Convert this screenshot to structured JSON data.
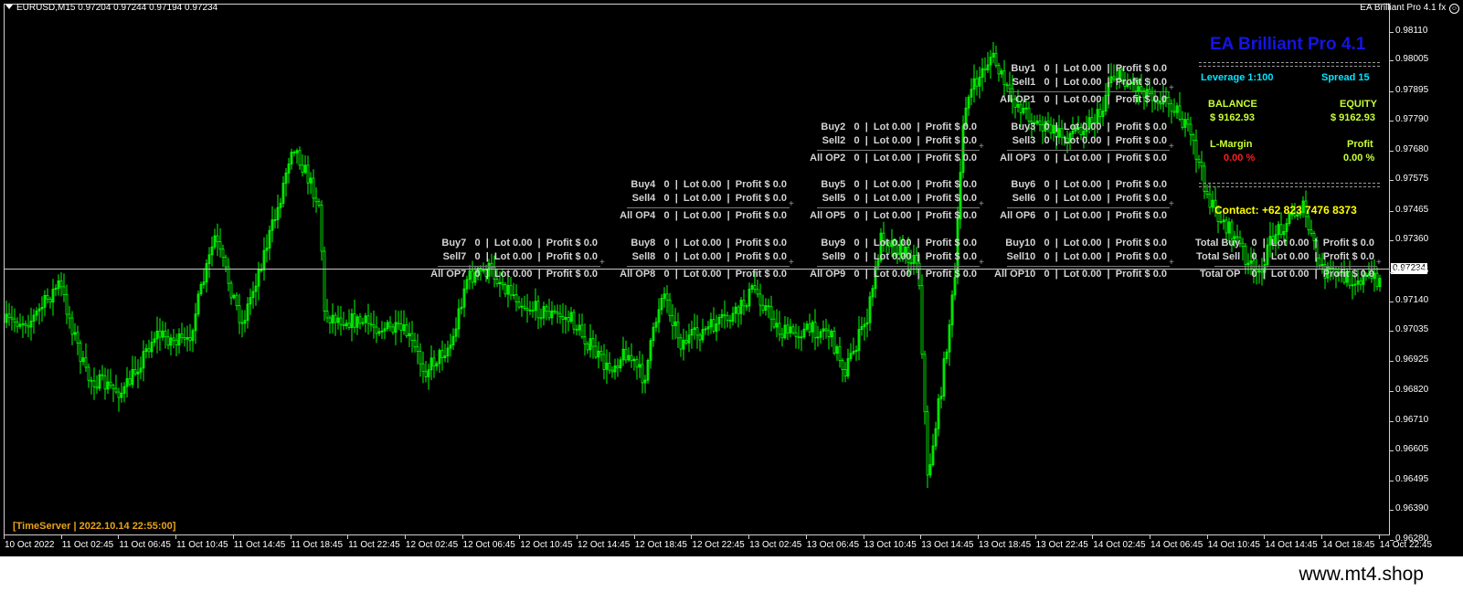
{
  "header": {
    "symbol_line": "EURUSD,M15  0.97204 0.97244 0.97194 0.97234",
    "ea_label": "EA Brilliant Pro 4.1 fx",
    "smiley_icon": "smiley-face-icon"
  },
  "price_scale": [
    "0.98110",
    "0.98005",
    "0.97895",
    "0.97790",
    "0.97680",
    "0.97575",
    "0.97465",
    "0.97360",
    "0.97255",
    "0.97140",
    "0.97035",
    "0.96925",
    "0.96820",
    "0.96710",
    "0.96605",
    "0.96495",
    "0.96390",
    "0.96280"
  ],
  "current_price": "0.97234",
  "time_scale": [
    "10 Oct 2022",
    "11 Oct 02:45",
    "11 Oct 06:45",
    "11 Oct 10:45",
    "11 Oct 14:45",
    "11 Oct 18:45",
    "11 Oct 22:45",
    "12 Oct 02:45",
    "12 Oct 06:45",
    "12 Oct 10:45",
    "12 Oct 14:45",
    "12 Oct 18:45",
    "12 Oct 22:45",
    "13 Oct 02:45",
    "13 Oct 06:45",
    "13 Oct 10:45",
    "13 Oct 14:45",
    "13 Oct 18:45",
    "13 Oct 22:45",
    "14 Oct 02:45",
    "14 Oct 06:45",
    "14 Oct 10:45",
    "14 Oct 14:45",
    "14 Oct 18:45",
    "14 Oct 22:45"
  ],
  "order_blocks": [
    {
      "buy": "Buy1   0  |  Lot 0.00  |  Profit $ 0.0",
      "sell": "Sell1   0  |  Lot 0.00  |  Profit $ 0.0",
      "all": "All OP1   0  |  Lot 0.00  |  Profit $ 0.0"
    },
    {
      "buy": "Buy2   0  |  Lot 0.00  |  Profit $ 0.0",
      "sell": "Sell2   0  |  Lot 0.00  |  Profit $ 0.0",
      "all": "All OP2   0  |  Lot 0.00  |  Profit $ 0.0"
    },
    {
      "buy": "Buy3   0  |  Lot 0.00  |  Profit $ 0.0",
      "sell": "Sell3   0  |  Lot 0.00  |  Profit $ 0.0",
      "all": "All OP3   0  |  Lot 0.00  |  Profit $ 0.0"
    },
    {
      "buy": "Buy4   0  |  Lot 0.00  |  Profit $ 0.0",
      "sell": "Sell4   0  |  Lot 0.00  |  Profit $ 0.0",
      "all": "All OP4   0  |  Lot 0.00  |  Profit $ 0.0"
    },
    {
      "buy": "Buy5   0  |  Lot 0.00  |  Profit $ 0.0",
      "sell": "Sell5   0  |  Lot 0.00  |  Profit $ 0.0",
      "all": "All OP5   0  |  Lot 0.00  |  Profit $ 0.0"
    },
    {
      "buy": "Buy6   0  |  Lot 0.00  |  Profit $ 0.0",
      "sell": "Sell6   0  |  Lot 0.00  |  Profit $ 0.0",
      "all": "All OP6   0  |  Lot 0.00  |  Profit $ 0.0"
    },
    {
      "buy": "Buy7   0  |  Lot 0.00  |  Profit $ 0.0",
      "sell": "Sell7   0  |  Lot 0.00  |  Profit $ 0.0",
      "all": "All OP7   0  |  Lot 0.00  |  Profit $ 0.0"
    },
    {
      "buy": "Buy8   0  |  Lot 0.00  |  Profit $ 0.0",
      "sell": "Sell8   0  |  Lot 0.00  |  Profit $ 0.0",
      "all": "All OP8   0  |  Lot 0.00  |  Profit $ 0.0"
    },
    {
      "buy": "Buy9   0  |  Lot 0.00  |  Profit $ 0.0",
      "sell": "Sell9   0  |  Lot 0.00  |  Profit $ 0.0",
      "all": "All OP9   0  |  Lot 0.00  |  Profit $ 0.0"
    },
    {
      "buy": "Buy10   0  |  Lot 0.00  |  Profit $ 0.0",
      "sell": "Sell10   0  |  Lot 0.00  |  Profit $ 0.0",
      "all": "All OP10   0  |  Lot 0.00  |  Profit $ 0.0"
    },
    {
      "buy": "Total Buy    0  |  Lot 0.00  |  Profit $ 0.0",
      "sell": "Total Sell    0  |  Lot 0.00  |  Profit $ 0.0",
      "all": "Total OP    0  |  Lot 0.00  |  Profit $ 0.0"
    }
  ],
  "ea_panel": {
    "title": "EA Brilliant Pro 4.1",
    "leverage": "Leverage  1:100",
    "spread": "Spread   15",
    "balance_label": "BALANCE",
    "balance_value": "$ 9162.93",
    "equity_label": "EQUITY",
    "equity_value": "$ 9162.93",
    "margin_label": "L-Margin",
    "margin_value": "0.00 %",
    "profit_label": "Profit",
    "profit_value": "0.00 %",
    "contact": "Contact: +62 823 7476 8373"
  },
  "time_server": "[TimeServer | 2022.10.14 22:55:00]",
  "watermark": "www.mt4.shop",
  "colors": {
    "candle": "#00ff00",
    "title": "#1414e6",
    "cyan": "#00e5ff",
    "yellow_green": "#c8ff32",
    "red": "#ff1e1e",
    "contact": "#ffff00",
    "time_server": "#e8a317"
  }
}
